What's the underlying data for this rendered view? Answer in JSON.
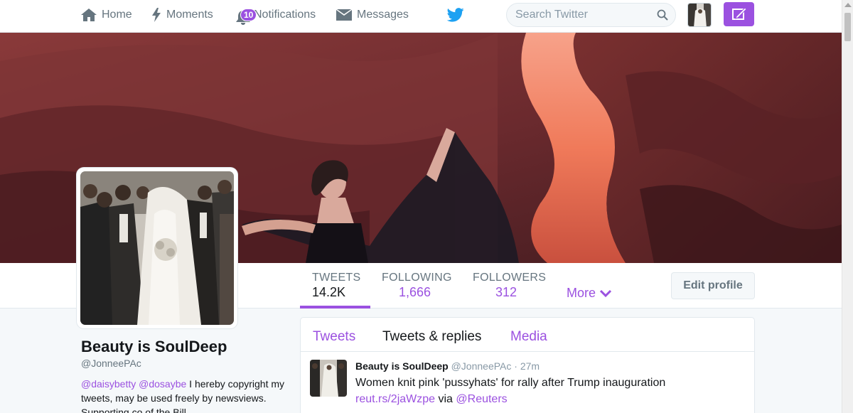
{
  "nav": {
    "home": "Home",
    "moments": "Moments",
    "notifications": "Notifications",
    "notifications_badge": "10",
    "messages": "Messages",
    "search_placeholder": "Search Twitter"
  },
  "stats": {
    "tweets_label": "TWEETS",
    "tweets_value": "14.2K",
    "following_label": "FOLLOWING",
    "following_value": "1,666",
    "followers_label": "FOLLOWERS",
    "followers_value": "312",
    "more_label": "More"
  },
  "edit_profile": "Edit profile",
  "profile": {
    "name": "Beauty is SoulDeep",
    "handle": "@JonneePAc",
    "bio_mention_1": "@daisybetty",
    "bio_mention_2": "@dosaybe",
    "bio_text": " I hereby copyright my tweets, may be used freely by newsviews. Supporting co of the Bill"
  },
  "tabs": {
    "tweets": "Tweets",
    "tweets_replies": "Tweets & replies",
    "media": "Media"
  },
  "tweet": {
    "name": "Beauty is SoulDeep",
    "handle": "@JonneePAc",
    "separator": " · ",
    "time": "27m",
    "text": "Women knit pink 'pussyhats' for rally after Trump inauguration",
    "link": "reut.rs/2jaWzpe",
    "via": " via ",
    "via_mention": "@Reuters"
  },
  "colors": {
    "accent": "#9b51e0",
    "twitter_blue": "#1da1f2",
    "text_gray": "#66757f"
  },
  "icons": [
    "home-icon",
    "moments-icon",
    "notifications-icon",
    "messages-icon",
    "twitter-bird-icon",
    "search-icon",
    "compose-icon",
    "chevron-down-icon"
  ]
}
